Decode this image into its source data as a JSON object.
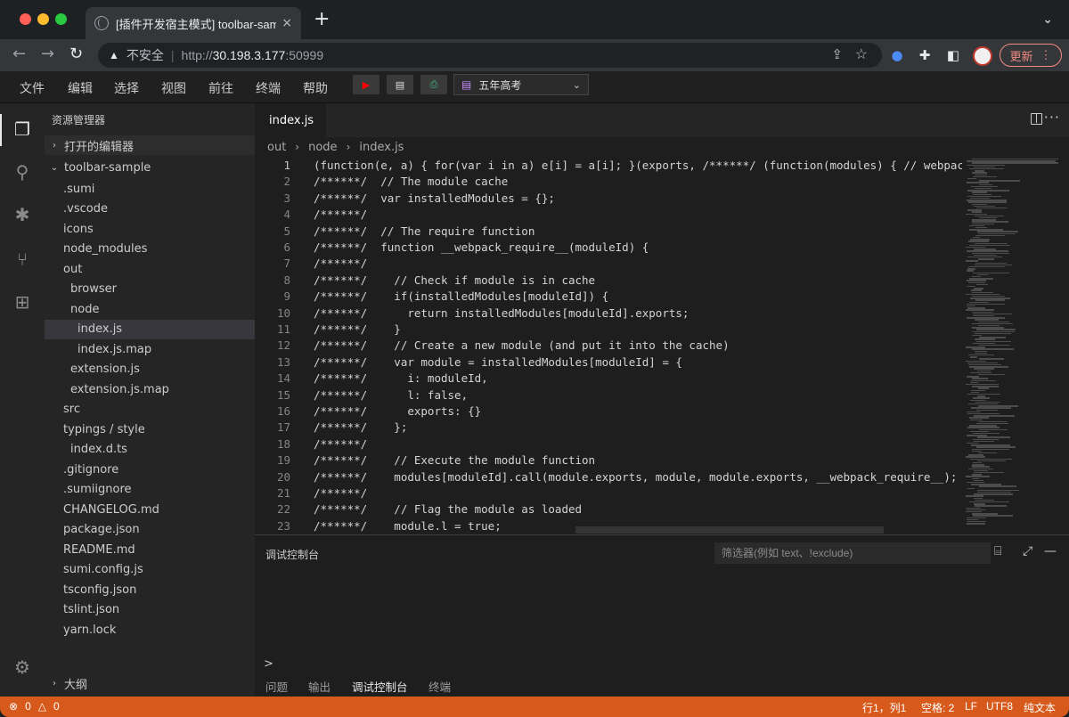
{
  "browser": {
    "tab_title": "[插件开发宿主模式] toolbar-sample",
    "tab_close": "×",
    "new_tab": "+",
    "insecure_label": "不安全",
    "url_scheme": "http://",
    "url_host": "30.198.3.177",
    "url_port": ":50999",
    "update_label": "更新",
    "update_more": "⋮"
  },
  "menubar": {
    "items": [
      "文件",
      "编辑",
      "选择",
      "视图",
      "前往",
      "终端",
      "帮助"
    ]
  },
  "toolbar": {
    "select_value": "五年高考"
  },
  "sidebar": {
    "title": "资源管理器",
    "open_editors": "打开的编辑器",
    "root": "toolbar-sample",
    "outline": "大纲",
    "tree": [
      {
        "label": ".sumi",
        "indent": 1
      },
      {
        "label": ".vscode",
        "indent": 1
      },
      {
        "label": "icons",
        "indent": 1
      },
      {
        "label": "node_modules",
        "indent": 1
      },
      {
        "label": "out",
        "indent": 1
      },
      {
        "label": "browser",
        "indent": 2
      },
      {
        "label": "node",
        "indent": 2
      },
      {
        "label": "index.js",
        "indent": 3,
        "selected": true
      },
      {
        "label": "index.js.map",
        "indent": 3
      },
      {
        "label": "extension.js",
        "indent": 2
      },
      {
        "label": "extension.js.map",
        "indent": 2
      },
      {
        "label": "src",
        "indent": 1
      },
      {
        "label": "typings / style",
        "indent": 1
      },
      {
        "label": "index.d.ts",
        "indent": 2
      },
      {
        "label": ".gitignore",
        "indent": 1
      },
      {
        "label": ".sumiignore",
        "indent": 1
      },
      {
        "label": "CHANGELOG.md",
        "indent": 1
      },
      {
        "label": "package.json",
        "indent": 1
      },
      {
        "label": "README.md",
        "indent": 1
      },
      {
        "label": "sumi.config.js",
        "indent": 1
      },
      {
        "label": "tsconfig.json",
        "indent": 1
      },
      {
        "label": "tslint.json",
        "indent": 1
      },
      {
        "label": "yarn.lock",
        "indent": 1
      }
    ]
  },
  "editor": {
    "tab": "index.js",
    "more": "···",
    "breadcrumbs": [
      "out",
      "node",
      "index.js"
    ],
    "lines": [
      {
        "n": "1",
        "text": "(function(e, a) { for(var i in a) e[i] = a[i]; }(exports, /******/ (function(modules) { // webpackBootstrap"
      },
      {
        "n": "2",
        "text": "/******/  // The module cache"
      },
      {
        "n": "3",
        "text": "/******/  var installedModules = {};"
      },
      {
        "n": "4",
        "text": "/******/"
      },
      {
        "n": "5",
        "text": "/******/  // The require function"
      },
      {
        "n": "6",
        "text": "/******/  function __webpack_require__(moduleId) {"
      },
      {
        "n": "7",
        "text": "/******/"
      },
      {
        "n": "8",
        "text": "/******/    // Check if module is in cache"
      },
      {
        "n": "9",
        "text": "/******/    if(installedModules[moduleId]) {"
      },
      {
        "n": "10",
        "text": "/******/      return installedModules[moduleId].exports;"
      },
      {
        "n": "11",
        "text": "/******/    }"
      },
      {
        "n": "12",
        "text": "/******/    // Create a new module (and put it into the cache)"
      },
      {
        "n": "13",
        "text": "/******/    var module = installedModules[moduleId] = {"
      },
      {
        "n": "14",
        "text": "/******/      i: moduleId,"
      },
      {
        "n": "15",
        "text": "/******/      l: false,"
      },
      {
        "n": "16",
        "text": "/******/      exports: {}"
      },
      {
        "n": "17",
        "text": "/******/    };"
      },
      {
        "n": "18",
        "text": "/******/"
      },
      {
        "n": "19",
        "text": "/******/    // Execute the module function"
      },
      {
        "n": "20",
        "text": "/******/    modules[moduleId].call(module.exports, module, module.exports, __webpack_require__);"
      },
      {
        "n": "21",
        "text": "/******/"
      },
      {
        "n": "22",
        "text": "/******/    // Flag the module as loaded"
      },
      {
        "n": "23",
        "text": "/******/    module.l = true;"
      }
    ]
  },
  "panel": {
    "title": "调试控制台",
    "filter_placeholder": "筛选器(例如 text、!exclude)",
    "prompt": ">",
    "tabs": [
      "问题",
      "输出",
      "调试控制台",
      "终端"
    ],
    "active_tab": "调试控制台"
  },
  "statusbar": {
    "errors": "0",
    "warnings": "0",
    "position": "行1，列1",
    "spaces": "空格: 2",
    "eol": "LF",
    "encoding": "UTF8",
    "language": "纯文本"
  },
  "colors": {
    "statusbar": "#d75a1c",
    "update_accent": "#f28b82"
  }
}
